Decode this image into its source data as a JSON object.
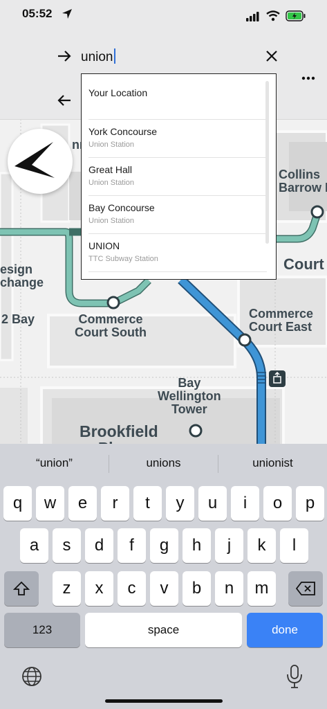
{
  "status": {
    "time": "05:52"
  },
  "search": {
    "value": "union"
  },
  "suggestions": [
    {
      "title": "Your Location",
      "subtitle": ""
    },
    {
      "title": "York Concourse",
      "subtitle": "Union Station"
    },
    {
      "title": "Great Hall",
      "subtitle": "Union Station"
    },
    {
      "title": "Bay Concourse",
      "subtitle": "Union Station"
    },
    {
      "title": "UNION",
      "subtitle": "TTC Subway Station"
    }
  ],
  "map": {
    "labels": {
      "collins": "Collins\nBarrow P",
      "design": "esign\nchange",
      "bay2": "2 Bay",
      "commerce_south": "Commerce\nCourt South",
      "commerce_east": "Commerce\nCourt East",
      "court": "Court",
      "bay_wellington": "Bay\nWellington\nTower",
      "brookfield": "Brookfield\nPlace",
      "fragment": "nn"
    }
  },
  "keyboard": {
    "predictions": [
      "“union”",
      "unions",
      "unionist"
    ],
    "row1": [
      "q",
      "w",
      "e",
      "r",
      "t",
      "y",
      "u",
      "i",
      "o",
      "p"
    ],
    "row2": [
      "a",
      "s",
      "d",
      "f",
      "g",
      "h",
      "j",
      "k",
      "l"
    ],
    "row3": [
      "z",
      "x",
      "c",
      "v",
      "b",
      "n",
      "m"
    ],
    "numbers_label": "123",
    "space_label": "space",
    "done_label": "done"
  },
  "colors": {
    "accent": "#3a82f6",
    "line_blue": "#3f95d6",
    "line_teal": "#7ec3b3"
  },
  "icons": [
    "location-arrow-icon",
    "signal-icon",
    "wifi-icon",
    "battery-icon",
    "forward-arrow-icon",
    "clear-icon",
    "back-arrow-icon",
    "more-icon",
    "compass-icon",
    "transfer-icon",
    "shift-icon",
    "backspace-icon",
    "globe-icon",
    "microphone-icon"
  ]
}
